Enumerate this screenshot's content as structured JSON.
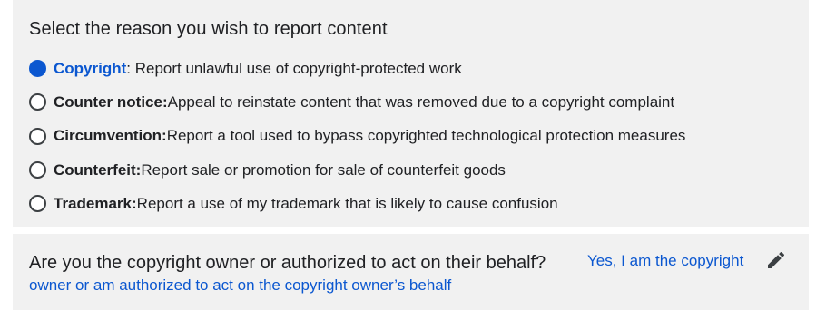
{
  "reason_section": {
    "heading": "Select the reason you wish to report content",
    "options": [
      {
        "name": "Copyright",
        "description": ": Report unlawful use of copyright-protected work",
        "selected": true
      },
      {
        "name": "Counter notice:",
        "description": " Appeal to reinstate content that was removed due to a copyright complaint",
        "selected": false
      },
      {
        "name": "Circumvention:",
        "description": " Report a tool used to bypass copyrighted technological protection measures",
        "selected": false
      },
      {
        "name": "Counterfeit:",
        "description": " Report sale or promotion for sale of counterfeit goods",
        "selected": false
      },
      {
        "name": "Trademark:",
        "description": " Report a use of my trademark that is likely to cause confusion",
        "selected": false
      }
    ]
  },
  "owner_section": {
    "question": "Are you the copyright owner or authorized to act on their behalf?",
    "answer_line1": "Yes, I am the copyright",
    "answer_line2": "owner or am authorized to act on the copyright owner’s behalf",
    "edit_icon": "pencil-icon"
  },
  "colors": {
    "accent": "#0b57d0",
    "panel_bg": "#f1f1f1",
    "text": "#202124"
  }
}
